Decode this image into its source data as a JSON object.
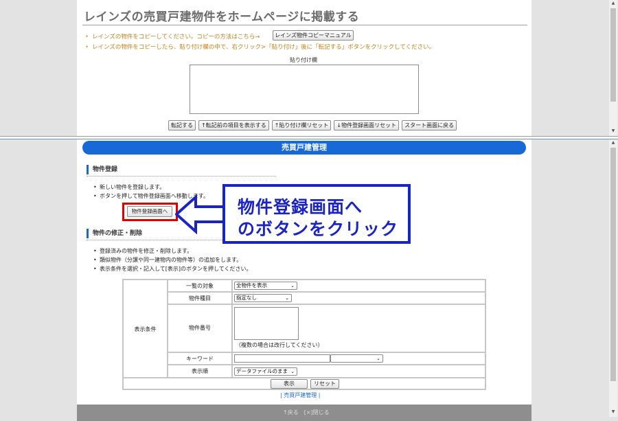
{
  "top": {
    "title": "レインズの売買戸建物件をホームページに掲載する",
    "bullet1": "レインズの物件をコピーしてください。コピーの方法はこちら→",
    "manual_button": "レインズ物件コピーマニュアル",
    "bullet2": "レインズの物件をコピーしたら、貼り付け欄の中で、右クリック>「貼り付け」後に「転記する」ボタンをクリックしてください。",
    "paste_label": "貼り付け欄",
    "paste_value": "",
    "buttons": [
      "転記する",
      "↑転記前の項目を表示する",
      "↑貼り付け欄リセット",
      "↓物件登録画面リセット",
      "スタート画面に戻る"
    ]
  },
  "bottom": {
    "banner": "売買戸建管理",
    "register": {
      "heading": "物件登録",
      "bullets": [
        "新しい物件を登録します。",
        "ボタンを押して物件登録画面へ移動します。"
      ],
      "button": "物件登録画面へ"
    },
    "modify": {
      "heading": "物件の修正・削除",
      "bullets": [
        "登録済みの物件を修正・削除します。",
        "類似物件（分譲や同一建物内の物件等）の追加をします。",
        "表示条件を選択・記入して[表示]のボタンを押してください。"
      ]
    },
    "conditions": {
      "group_label": "表示条件",
      "list_target_label": "一覧の対象",
      "list_target_value": "全物件を表示",
      "type_label": "物件種目",
      "type_value": "指定なし",
      "number_label": "物件番号",
      "number_note": "（複数の場合は改行してください）",
      "keyword_label": "キーワード",
      "keyword_value": "",
      "keyword_select_value": "",
      "order_label": "表示順",
      "order_value": "データファイルのまま",
      "show_button": "表示",
      "reset_button": "リセット"
    },
    "footer_link": "| 売買戸建管理 |",
    "footer_bar_text": "↑戻る　[×]閉じる"
  },
  "annotation": {
    "line1": "物件登録画面へ",
    "line2": "のボタンをクリック",
    "color": "#1a23c8",
    "highlight_color": "#e10000"
  },
  "colors": {
    "accent": "#1769d8",
    "orange": "#c8811a"
  }
}
